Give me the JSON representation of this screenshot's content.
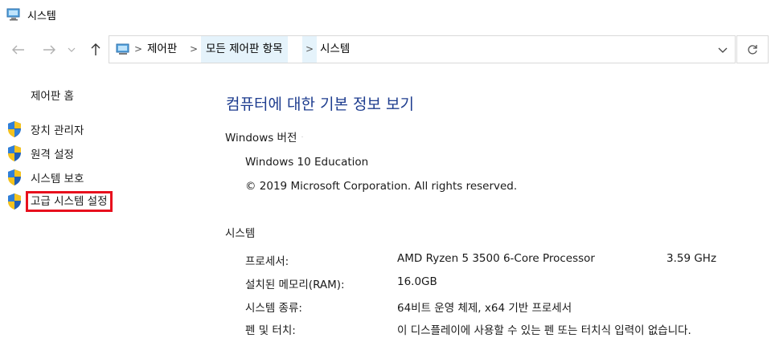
{
  "window": {
    "title": "시스템",
    "icon": "system-computer-icon"
  },
  "nav": {
    "back_icon": "arrow-left-icon",
    "forward_icon": "arrow-right-icon",
    "recent_icon": "chevron-down-icon",
    "up_icon": "arrow-up-icon",
    "refresh_icon": "refresh-icon"
  },
  "address_bar": {
    "crumbs": [
      {
        "label": "제어판"
      },
      {
        "label": "모든 제어판 항목"
      },
      {
        "label": "시스템"
      }
    ],
    "separator": ">"
  },
  "sidebar": {
    "home_label": "제어판 홈",
    "items": [
      {
        "label": "장치 관리자",
        "icon": "shield-icon"
      },
      {
        "label": "원격 설정",
        "icon": "shield-icon"
      },
      {
        "label": "시스템 보호",
        "icon": "shield-icon"
      },
      {
        "label": "고급 시스템 설정",
        "icon": "shield-icon",
        "highlighted": true
      }
    ]
  },
  "main": {
    "title": "컴퓨터에 대한 기본 정보 보기",
    "windows_section": {
      "heading": "Windows 버전",
      "edition": "Windows 10 Education",
      "copyright": "© 2019 Microsoft Corporation. All rights reserved."
    },
    "system_section": {
      "heading": "시스템",
      "rows": [
        {
          "label": "프로세서:",
          "value": "AMD Ryzen 5 3500 6-Core Processor",
          "extra": "3.59 GHz"
        },
        {
          "label": "설치된 메모리(RAM):",
          "value": "16.0GB"
        },
        {
          "label": "시스템 종류:",
          "value": "64비트 운영 체제, x64 기반 프로세서"
        },
        {
          "label": "펜 및 터치:",
          "value": "이 디스플레이에 사용할 수 있는 펜 또는 터치식 입력이 없습니다."
        }
      ]
    }
  },
  "colors": {
    "title_blue": "#1e3d8f",
    "highlight_red": "#e8101d",
    "crumb_active_bg": "#e5f3fb"
  }
}
